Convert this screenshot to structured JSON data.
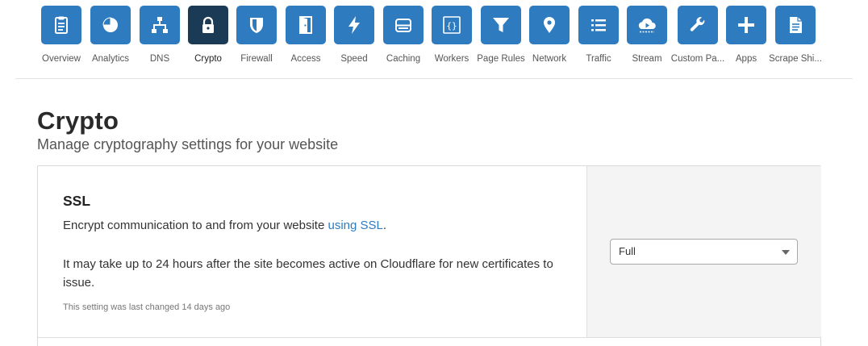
{
  "nav": {
    "items": [
      {
        "label": "Overview",
        "icon": "clipboard-icon",
        "active": false
      },
      {
        "label": "Analytics",
        "icon": "pie-chart-icon",
        "active": false
      },
      {
        "label": "DNS",
        "icon": "network-tree-icon",
        "active": false
      },
      {
        "label": "Crypto",
        "icon": "lock-icon",
        "active": true
      },
      {
        "label": "Firewall",
        "icon": "shield-icon",
        "active": false
      },
      {
        "label": "Access",
        "icon": "door-icon",
        "active": false
      },
      {
        "label": "Speed",
        "icon": "lightning-icon",
        "active": false
      },
      {
        "label": "Caching",
        "icon": "server-icon",
        "active": false
      },
      {
        "label": "Workers",
        "icon": "code-braces-icon",
        "active": false
      },
      {
        "label": "Page Rules",
        "icon": "filter-icon",
        "active": false
      },
      {
        "label": "Network",
        "icon": "map-pin-icon",
        "active": false
      },
      {
        "label": "Traffic",
        "icon": "list-icon",
        "active": false
      },
      {
        "label": "Stream",
        "icon": "cloud-play-icon",
        "active": false
      },
      {
        "label": "Custom Pa...",
        "icon": "wrench-icon",
        "active": false
      },
      {
        "label": "Apps",
        "icon": "plus-icon",
        "active": false
      },
      {
        "label": "Scrape Shi...",
        "icon": "document-icon",
        "active": false
      }
    ],
    "colors": {
      "tile": "#2f7bbf",
      "active_tile": "#1b3a55"
    }
  },
  "page": {
    "title": "Crypto",
    "subtitle": "Manage cryptography settings for your website"
  },
  "ssl": {
    "title": "SSL",
    "desc_prefix": "Encrypt communication to and from your website ",
    "desc_link": "using SSL",
    "desc_suffix": ".",
    "note": "It may take up to 24 hours after the site becomes active on Cloudflare for new certificates to issue.",
    "last_changed": "This setting was last changed 14 days ago",
    "mode_value": "Full"
  }
}
